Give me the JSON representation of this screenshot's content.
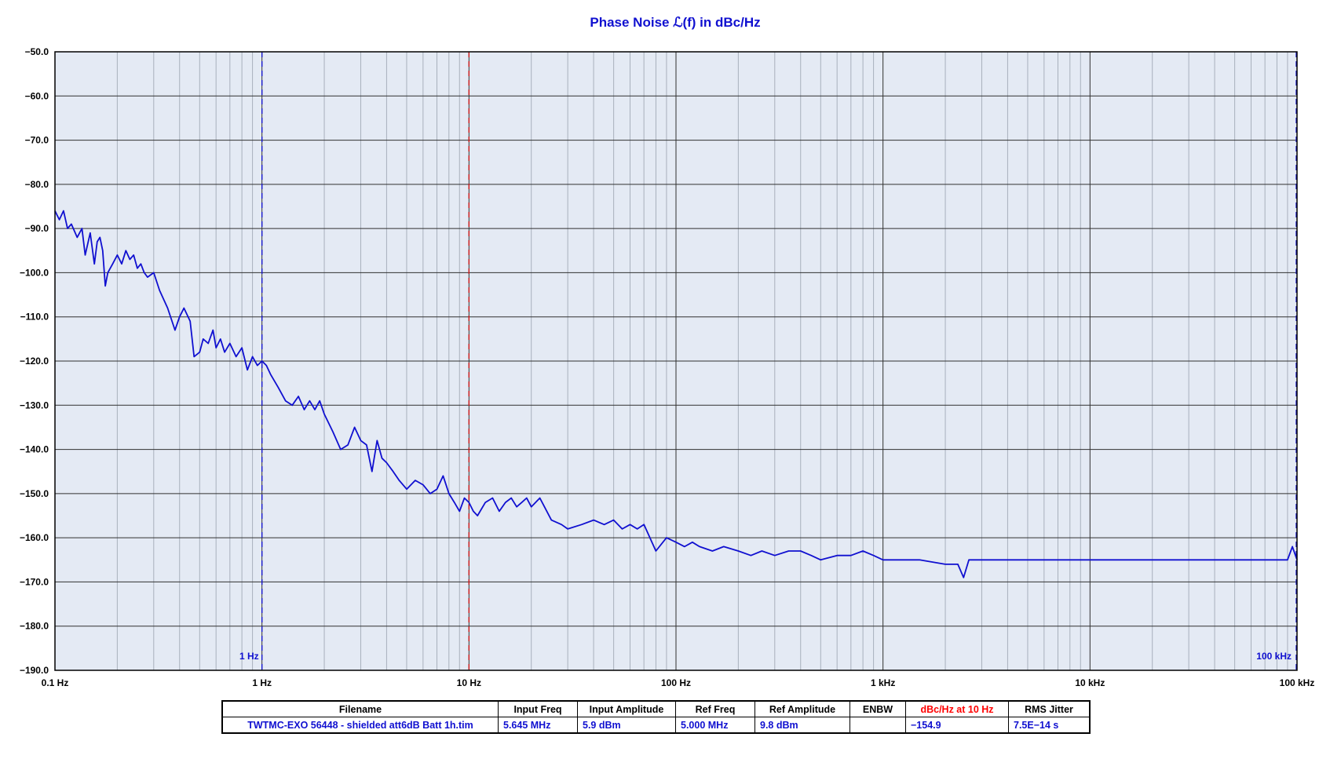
{
  "chart_data": {
    "type": "line",
    "title": "Phase Noise ℒ(f) in dBc/Hz",
    "x_scale": "log",
    "xlim": [
      0.1,
      100000
    ],
    "ylim": [
      -190,
      -50
    ],
    "grid": true,
    "x_tick_labels": [
      "0.1 Hz",
      "1 Hz",
      "10 Hz",
      "100 Hz",
      "1 kHz",
      "10 kHz",
      "100 kHz"
    ],
    "x_tick_values": [
      0.1,
      1,
      10,
      100,
      1000,
      10000,
      100000
    ],
    "y_tick_values": [
      -50,
      -60,
      -70,
      -80,
      -90,
      -100,
      -110,
      -120,
      -130,
      -140,
      -150,
      -160,
      -170,
      -180,
      -190
    ],
    "y_tick_labels": [
      "−50.0",
      "−60.0",
      "−70.0",
      "−80.0",
      "−90.0",
      "−100.0",
      "−110.0",
      "−120.0",
      "−130.0",
      "−140.0",
      "−150.0",
      "−160.0",
      "−170.0",
      "−180.0",
      "−190.0"
    ],
    "markers": [
      {
        "x": 1,
        "label": "1 Hz",
        "color": "#1010d0"
      },
      {
        "x": 10,
        "label": "",
        "color": "#d01010"
      },
      {
        "x": 100000,
        "label": "100 kHz",
        "color": "#1010d0"
      }
    ],
    "colors": {
      "plot_bg": "#e4eaf4",
      "trace": "#1010d0",
      "title": "#1010d0",
      "highlight": "#ff0000"
    },
    "series": [
      {
        "color": "#1010d0",
        "x": [
          0.1,
          0.105,
          0.11,
          0.115,
          0.12,
          0.128,
          0.135,
          0.14,
          0.148,
          0.155,
          0.16,
          0.165,
          0.17,
          0.175,
          0.18,
          0.19,
          0.2,
          0.21,
          0.22,
          0.23,
          0.24,
          0.25,
          0.26,
          0.27,
          0.28,
          0.3,
          0.32,
          0.35,
          0.38,
          0.4,
          0.42,
          0.45,
          0.47,
          0.5,
          0.52,
          0.55,
          0.58,
          0.6,
          0.63,
          0.66,
          0.7,
          0.75,
          0.8,
          0.85,
          0.9,
          0.95,
          1.0,
          1.05,
          1.1,
          1.2,
          1.3,
          1.4,
          1.5,
          1.6,
          1.7,
          1.8,
          1.9,
          2.0,
          2.2,
          2.4,
          2.6,
          2.8,
          3.0,
          3.2,
          3.4,
          3.6,
          3.8,
          4.0,
          4.3,
          4.6,
          5.0,
          5.5,
          6.0,
          6.5,
          7.0,
          7.5,
          8.0,
          8.5,
          9.0,
          9.5,
          10,
          10.5,
          11,
          12,
          13,
          14,
          15,
          16,
          17,
          18,
          19,
          20,
          22,
          25,
          28,
          30,
          35,
          40,
          45,
          50,
          55,
          60,
          65,
          70,
          80,
          90,
          100,
          110,
          120,
          130,
          150,
          170,
          200,
          230,
          260,
          300,
          350,
          400,
          450,
          500,
          600,
          700,
          800,
          900,
          1000,
          1200,
          1500,
          2000,
          2300,
          2450,
          2600,
          3000,
          4000,
          5000,
          7000,
          10000,
          15000,
          20000,
          30000,
          50000,
          70000,
          90000,
          95000,
          100000
        ],
        "y": [
          -86,
          -88,
          -86,
          -90,
          -89,
          -92,
          -90,
          -96,
          -91,
          -98,
          -93,
          -92,
          -95,
          -103,
          -100,
          -98,
          -96,
          -98,
          -95,
          -97,
          -96,
          -99,
          -98,
          -100,
          -101,
          -100,
          -104,
          -108,
          -113,
          -110,
          -108,
          -111,
          -119,
          -118,
          -115,
          -116,
          -113,
          -117,
          -115,
          -118,
          -116,
          -119,
          -117,
          -122,
          -119,
          -121,
          -120,
          -121,
          -123,
          -126,
          -129,
          -130,
          -128,
          -131,
          -129,
          -131,
          -129,
          -132,
          -136,
          -140,
          -139,
          -135,
          -138,
          -139,
          -145,
          -138,
          -142,
          -143,
          -145,
          -147,
          -149,
          -147,
          -148,
          -150,
          -149,
          -146,
          -150,
          -152,
          -154,
          -151,
          -152,
          -154,
          -155,
          -152,
          -151,
          -154,
          -152,
          -151,
          -153,
          -152,
          -151,
          -153,
          -151,
          -156,
          -157,
          -158,
          -157,
          -156,
          -157,
          -156,
          -158,
          -157,
          -158,
          -157,
          -163,
          -160,
          -161,
          -162,
          -161,
          -162,
          -163,
          -162,
          -163,
          -164,
          -163,
          -164,
          -163,
          -163,
          -164,
          -165,
          -164,
          -164,
          -163,
          -164,
          -165,
          -165,
          -165,
          -166,
          -166,
          -169,
          -165,
          -165,
          -165,
          -165,
          -165,
          -165,
          -165,
          -165,
          -165,
          -165,
          -165,
          -165,
          -162,
          -165
        ]
      }
    ]
  },
  "info_table": {
    "headers": [
      "Filename",
      "Input Freq",
      "Input Amplitude",
      "Ref Freq",
      "Ref Amplitude",
      "ENBW",
      "dBc/Hz at 10 Hz",
      "RMS Jitter"
    ],
    "values": [
      "TWTMC-EXO 56448 - shielded att6dB Batt 1h.tim",
      "5.645 MHz",
      "5.9 dBm",
      "5.000 MHz",
      "9.8 dBm",
      "",
      "−154.9",
      "7.5E−14 s"
    ],
    "highlight_column": 6
  }
}
